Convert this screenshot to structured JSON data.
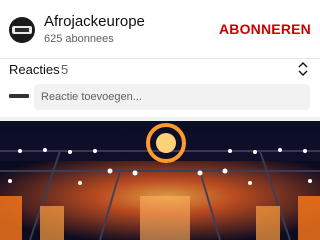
{
  "channel": {
    "name": "Afrojackeurope",
    "subscribers": "625 abonnees",
    "subscribe_label": "ABONNEREN"
  },
  "comments": {
    "title": "Reacties",
    "count": "5",
    "input_placeholder": "Reactie toevoegen..."
  },
  "colors": {
    "subscribe": "#cc0000",
    "secondary_text": "#606060",
    "input_bg": "#f2f2f2"
  },
  "icons": {
    "expand": "unfold-more-icon"
  }
}
